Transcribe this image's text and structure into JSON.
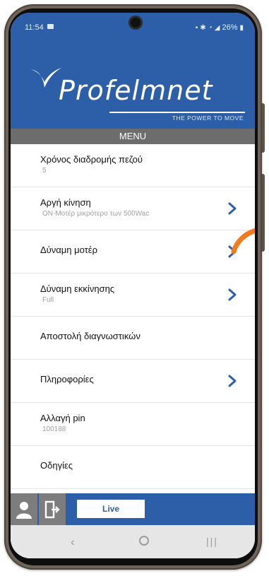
{
  "status": {
    "time": "11:54",
    "battery": "26%"
  },
  "brand": {
    "name": "Profelmnet",
    "tagline": "THE POWER TO MOVE"
  },
  "menu_title": "MENU",
  "items": [
    {
      "label": "Χρόνος διαδρομής πεζού",
      "value": "5",
      "chevron": false
    },
    {
      "label": "Αργή κίνηση",
      "value": "ON-Μοτέρ μικρότερο των 500Wac",
      "chevron": true
    },
    {
      "label": "Δύναμη μοτέρ",
      "value": "",
      "chevron": true
    },
    {
      "label": "Δύναμη εκκίνησης",
      "value": "Full",
      "chevron": true
    },
    {
      "label": "Αποστολή διαγνωστικών",
      "value": "",
      "chevron": false
    },
    {
      "label": "Πληροφορίες",
      "value": "",
      "chevron": true
    },
    {
      "label": "Αλλαγή pin",
      "value": "100188",
      "chevron": false
    },
    {
      "label": "Οδηγίες",
      "value": "",
      "chevron": false
    }
  ],
  "bottombar": {
    "live_label": "Live"
  },
  "colors": {
    "primary": "#2d5ea8",
    "menu_bar": "#6d6d6d",
    "chevron": "#2d5ea8",
    "swipe_hint": "#f07a1c"
  }
}
